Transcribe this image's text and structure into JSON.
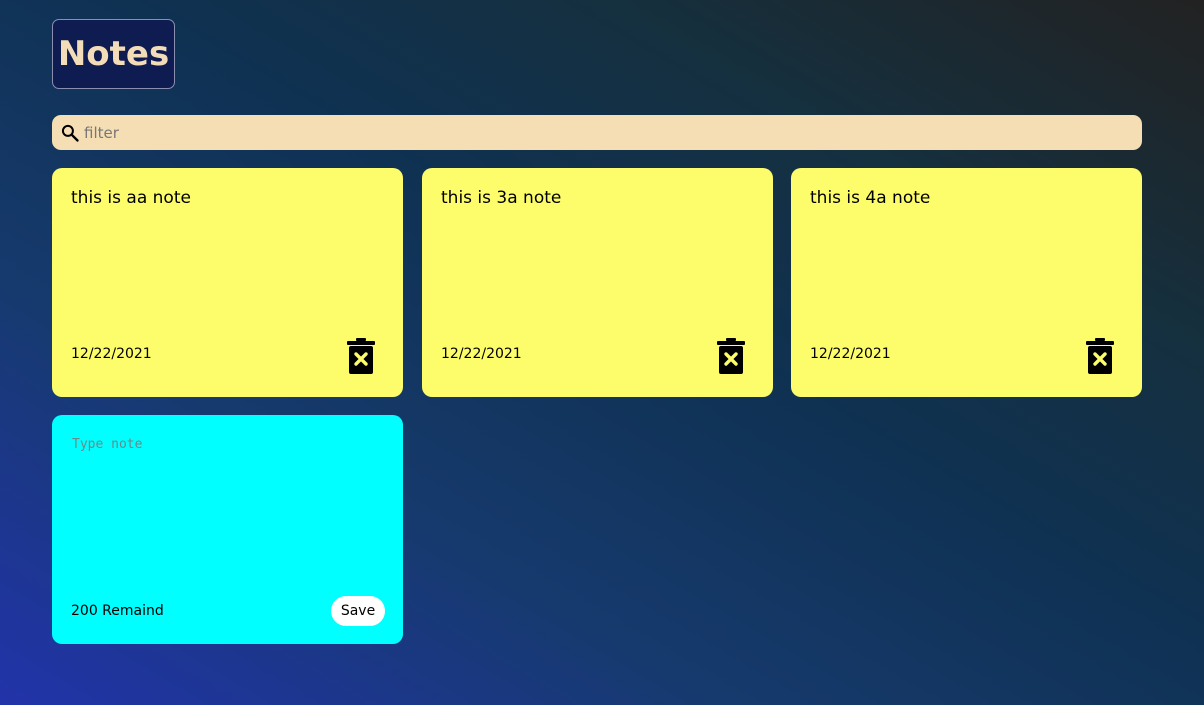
{
  "header": {
    "title": "Notes"
  },
  "search": {
    "placeholder": "filter",
    "value": ""
  },
  "notes": [
    {
      "text": "this is aa note",
      "date": "12/22/2021"
    },
    {
      "text": "this is 3a note",
      "date": "12/22/2021"
    },
    {
      "text": "this is 4a note",
      "date": "12/22/2021"
    }
  ],
  "new_note": {
    "placeholder": "Type note",
    "value": "",
    "remaining_text": "200 Remaind",
    "save_label": "Save"
  },
  "colors": {
    "note_background": "#fdfd6c",
    "new_note_background": "#00ffff",
    "search_background": "#f5deb3",
    "title_background": "#0f1c52",
    "title_text": "#f3dcb8",
    "trash_icon_cross": "#fdfd6c"
  },
  "icons": {
    "search": "search-icon",
    "delete": "trash-delete-icon"
  }
}
